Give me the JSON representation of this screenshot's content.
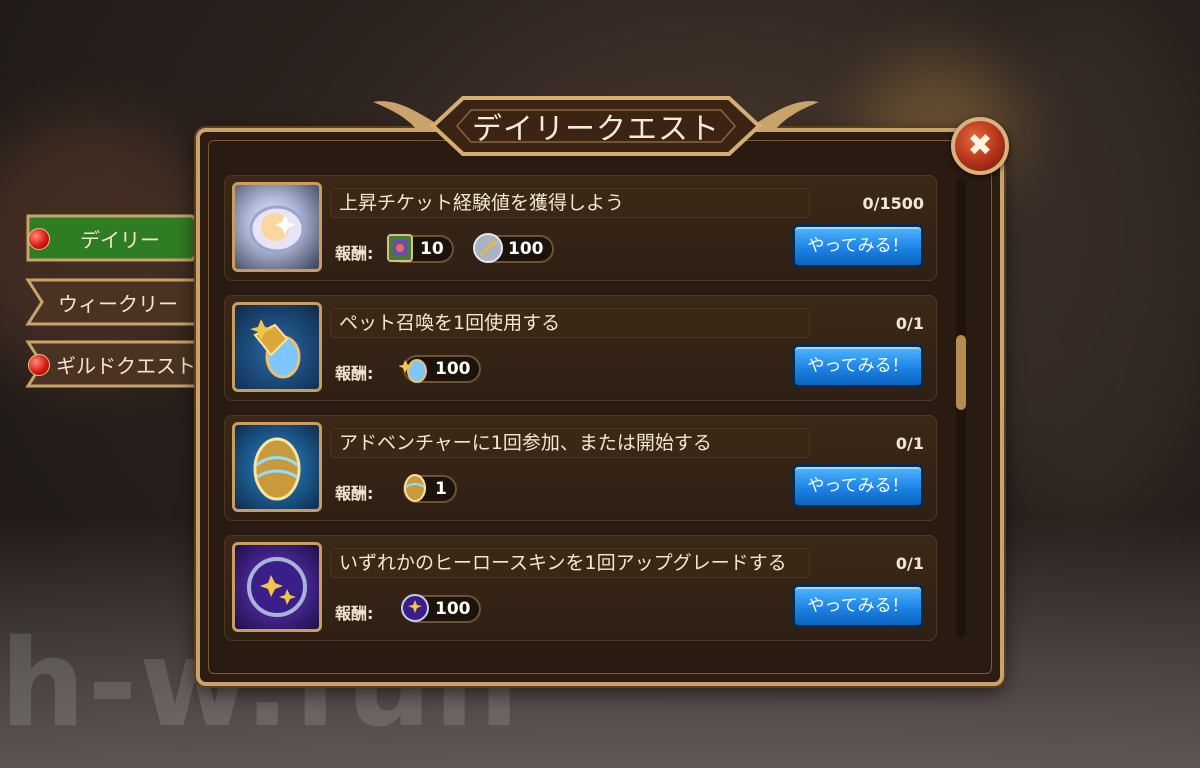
{
  "title": "デイリークエスト",
  "tabs": [
    {
      "label": "デイリー",
      "active": true,
      "badge": true
    },
    {
      "label": "ウィークリー",
      "active": false,
      "badge": false
    },
    {
      "label": "ギルドクエスト",
      "active": false,
      "badge": true
    }
  ],
  "reward_label": "報酬:",
  "go_label": "やってみる！",
  "quests": [
    {
      "title": "上昇チケット経験値を獲得しよう",
      "progress": "0/1500",
      "rewards": [
        {
          "icon": "card-icon",
          "amount": "10"
        },
        {
          "icon": "sword-coin-icon",
          "amount": "100"
        }
      ]
    },
    {
      "title": "ペット召喚を1回使用する",
      "progress": "0/1",
      "rewards": [
        {
          "icon": "pet-egg-icon",
          "amount": "100"
        }
      ]
    },
    {
      "title": "アドベンチャーに1回参加、または開始する",
      "progress": "0/1",
      "rewards": [
        {
          "icon": "golden-egg-icon",
          "amount": "1"
        }
      ]
    },
    {
      "title": "いずれかのヒーロースキンを1回アップグレードする",
      "progress": "0/1",
      "rewards": [
        {
          "icon": "star-coin-icon",
          "amount": "100"
        }
      ]
    }
  ],
  "watermark": "h-w.fun",
  "colors": {
    "accent_gold": "#c9a36a",
    "button_blue": "#1c84e6",
    "tab_green": "#2f7d22"
  }
}
